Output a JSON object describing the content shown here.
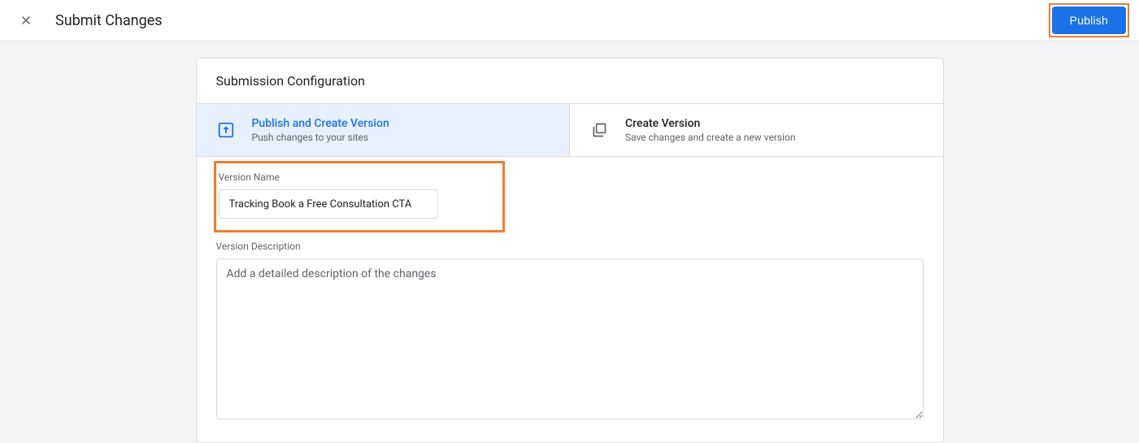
{
  "header": {
    "title": "Submit Changes",
    "publish_label": "Publish"
  },
  "card": {
    "heading": "Submission Configuration",
    "options": {
      "publish": {
        "title": "Publish and Create Version",
        "subtitle": "Push changes to your sites"
      },
      "create": {
        "title": "Create Version",
        "subtitle": "Save changes and create a new version"
      }
    },
    "version_name": {
      "label": "Version Name",
      "value": "Tracking Book a Free Consultation CTA"
    },
    "version_description": {
      "label": "Version Description",
      "placeholder": "Add a detailed description of the changes",
      "value": ""
    }
  }
}
